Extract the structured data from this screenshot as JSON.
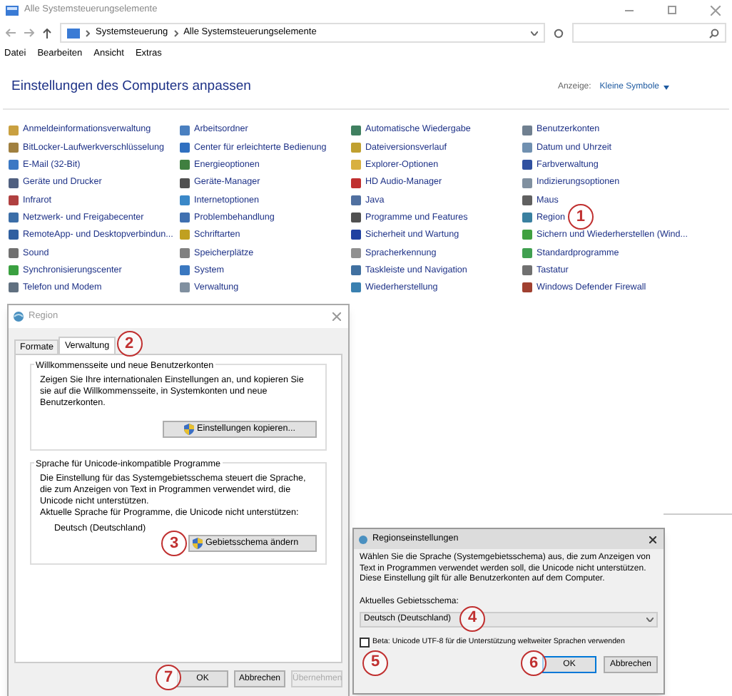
{
  "window": {
    "title": "Alle Systemsteuerungselemente"
  },
  "breadcrumb": [
    "Systemsteuerung",
    "Alle Systemsteuerungselemente"
  ],
  "menu": [
    "Datei",
    "Bearbeiten",
    "Ansicht",
    "Extras"
  ],
  "heading": "Einstellungen des Computers anpassen",
  "view": {
    "label": "Anzeige:",
    "value": "Kleine Symbole"
  },
  "items": [
    {
      "label": "Anmeldeinformationsverwaltung",
      "color": "#c9a040"
    },
    {
      "label": "BitLocker-Laufwerkverschlüsselung",
      "color": "#a08040"
    },
    {
      "label": "E-Mail (32-Bit)",
      "color": "#3b78c4"
    },
    {
      "label": "Geräte und Drucker",
      "color": "#506080"
    },
    {
      "label": "Infrarot",
      "color": "#b04040"
    },
    {
      "label": "Netzwerk- und Freigabecenter",
      "color": "#3b6ea8"
    },
    {
      "label": "RemoteApp- und Desktopverbindun...",
      "color": "#2f5fa0"
    },
    {
      "label": "Sound",
      "color": "#707070"
    },
    {
      "label": "Synchronisierungscenter",
      "color": "#3aa040"
    },
    {
      "label": "Telefon und Modem",
      "color": "#607080"
    },
    {
      "label": "Arbeitsordner",
      "color": "#4a80c0"
    },
    {
      "label": "Center für erleichterte Bedienung",
      "color": "#3070c0"
    },
    {
      "label": "Energieoptionen",
      "color": "#408040"
    },
    {
      "label": "Geräte-Manager",
      "color": "#505050"
    },
    {
      "label": "Internetoptionen",
      "color": "#3a88c8"
    },
    {
      "label": "Problembehandlung",
      "color": "#4070b0"
    },
    {
      "label": "Schriftarten",
      "color": "#c0a020"
    },
    {
      "label": "Speicherplätze",
      "color": "#808080"
    },
    {
      "label": "System",
      "color": "#3a78c0"
    },
    {
      "label": "Verwaltung",
      "color": "#8090a0"
    },
    {
      "label": "Automatische Wiedergabe",
      "color": "#408060"
    },
    {
      "label": "Dateiversionsverlauf",
      "color": "#c0a030"
    },
    {
      "label": "Explorer-Optionen",
      "color": "#d8b040"
    },
    {
      "label": "HD Audio-Manager",
      "color": "#c03030"
    },
    {
      "label": "Java",
      "color": "#5070a0"
    },
    {
      "label": "Programme und Features",
      "color": "#505050"
    },
    {
      "label": "Sicherheit und Wartung",
      "color": "#2040a0"
    },
    {
      "label": "Spracherkennung",
      "color": "#909090"
    },
    {
      "label": "Taskleiste und Navigation",
      "color": "#4070a0"
    },
    {
      "label": "Wiederherstellung",
      "color": "#3a80b0"
    },
    {
      "label": "Benutzerkonten",
      "color": "#708090"
    },
    {
      "label": "Datum und Uhrzeit",
      "color": "#7090b0"
    },
    {
      "label": "Farbverwaltung",
      "color": "#3050a0"
    },
    {
      "label": "Indizierungsoptionen",
      "color": "#8090a0"
    },
    {
      "label": "Maus",
      "color": "#606060"
    },
    {
      "label": "Region",
      "color": "#3a80a0",
      "callout": "1"
    },
    {
      "label": "Sichern und Wiederherstellen (Wind...",
      "color": "#40a040"
    },
    {
      "label": "Standardprogramme",
      "color": "#40a050"
    },
    {
      "label": "Tastatur",
      "color": "#707070"
    },
    {
      "label": "Windows Defender Firewall",
      "color": "#a04030"
    }
  ],
  "region_dialog": {
    "title": "Region",
    "tabs": [
      {
        "label": "Formate",
        "selected": false
      },
      {
        "label": "Verwaltung",
        "selected": true,
        "callout": "2"
      }
    ],
    "group1": {
      "title": "Willkommensseite und neue Benutzerkonten",
      "text": "Zeigen Sie Ihre internationalen Einstellungen an, und kopieren Sie sie auf die Willkommensseite, in Systemkonten und neue Benutzerkonten.",
      "button": "Einstellungen kopieren..."
    },
    "group2": {
      "title": "Sprache für Unicode-inkompatible Programme",
      "text": "Die Einstellung für das Systemgebietsschema steuert die Sprache, die zum Anzeigen von Text in Programmen verwendet wird, die Unicode nicht unterstützen.",
      "current_label": "Aktuelle Sprache für Programme, die Unicode nicht unterstützen:",
      "current_value": "Deutsch (Deutschland)",
      "button": "Gebietsschema ändern",
      "button_callout": "3"
    },
    "buttons": [
      {
        "label": "OK",
        "disabled": false,
        "callout": "7"
      },
      {
        "label": "Abbrechen",
        "disabled": false
      },
      {
        "label": "Übernehmen",
        "disabled": true
      }
    ]
  },
  "locale_dialog": {
    "title": "Regionseinstellungen",
    "text": "Wählen Sie die Sprache (Systemgebietsschema) aus, die zum Anzeigen von Text in Programmen verwendet werden soll, die Unicode nicht unterstützen. Diese Einstellung gilt für alle Benutzerkonten auf dem Computer.",
    "locale_label": "Aktuelles Gebietsschema:",
    "locale_value": "Deutsch (Deutschland)",
    "locale_callout": "4",
    "beta": {
      "label": "Beta: Unicode UTF-8 für die Unterstützung weltweiter Sprachen verwenden",
      "checked": false,
      "callout": "5"
    },
    "buttons": [
      {
        "label": "OK",
        "callout": "6"
      },
      {
        "label": "Abbrechen"
      }
    ]
  }
}
